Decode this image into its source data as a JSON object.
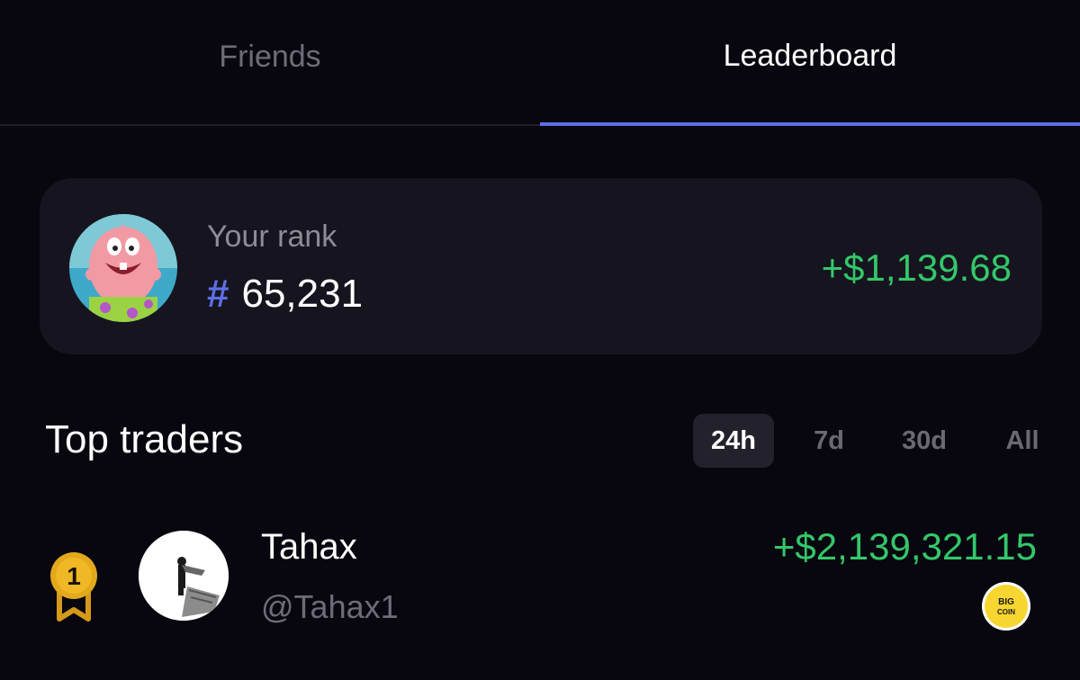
{
  "tabs": [
    {
      "label": "Friends",
      "active": false
    },
    {
      "label": "Leaderboard",
      "active": true
    }
  ],
  "rank_card": {
    "label": "Your rank",
    "hash": "#",
    "rank": "65,231",
    "pnl": "+$1,139.68"
  },
  "top_traders": {
    "title": "Top traders",
    "periods": [
      {
        "label": "24h",
        "selected": true
      },
      {
        "label": "7d",
        "selected": false
      },
      {
        "label": "30d",
        "selected": false
      },
      {
        "label": "All",
        "selected": false
      }
    ],
    "rows": [
      {
        "position": "1",
        "name": "Tahax",
        "handle": "@Tahax1",
        "pnl": "+$2,139,321.15",
        "badge_text": "BIG COIN"
      }
    ]
  },
  "colors": {
    "background": "#08070f",
    "card": "#16151f",
    "accent": "#5d6ee6",
    "positive": "#34c76a",
    "muted": "#6e6c78",
    "gold": "#e3a81c"
  }
}
